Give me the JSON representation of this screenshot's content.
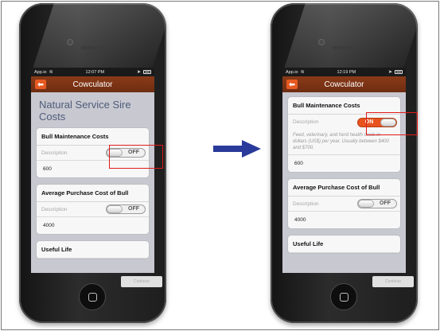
{
  "left_phone": {
    "status": {
      "carrier": "App.io",
      "time": "12:07 PM"
    },
    "nav": {
      "back": "⬅",
      "title": "Cowculator"
    },
    "page_title": "Natural Service Sire Costs",
    "cards": [
      {
        "title": "Bull Maintenance Costs",
        "row_label": "Description",
        "toggle": "OFF",
        "value": "600"
      },
      {
        "title": "Average Purchase Cost of Bull",
        "row_label": "Description",
        "toggle": "OFF",
        "value": "4000"
      },
      {
        "title": "Useful Life"
      }
    ],
    "ghost_button": "Continue"
  },
  "right_phone": {
    "status": {
      "carrier": "App.io",
      "time": "12:19 PM"
    },
    "nav": {
      "back": "⬅",
      "title": "Cowculator"
    },
    "cards": [
      {
        "title": "Bull Maintenance Costs",
        "row_label": "Description",
        "toggle": "ON",
        "description": "Feed, veterinary, and herd health costs in dollars (US$) per year. Usually between $400 and $700.",
        "value": "600"
      },
      {
        "title": "Average Purchase Cost of Bull",
        "row_label": "Description",
        "toggle": "OFF",
        "value": "4000"
      },
      {
        "title": "Useful Life"
      }
    ],
    "ghost_button": "Continue"
  },
  "colors": {
    "navbar": "#7a3214",
    "accent": "#e8531e",
    "highlight": "#e01b1b",
    "arrow": "#2a3a9a"
  }
}
